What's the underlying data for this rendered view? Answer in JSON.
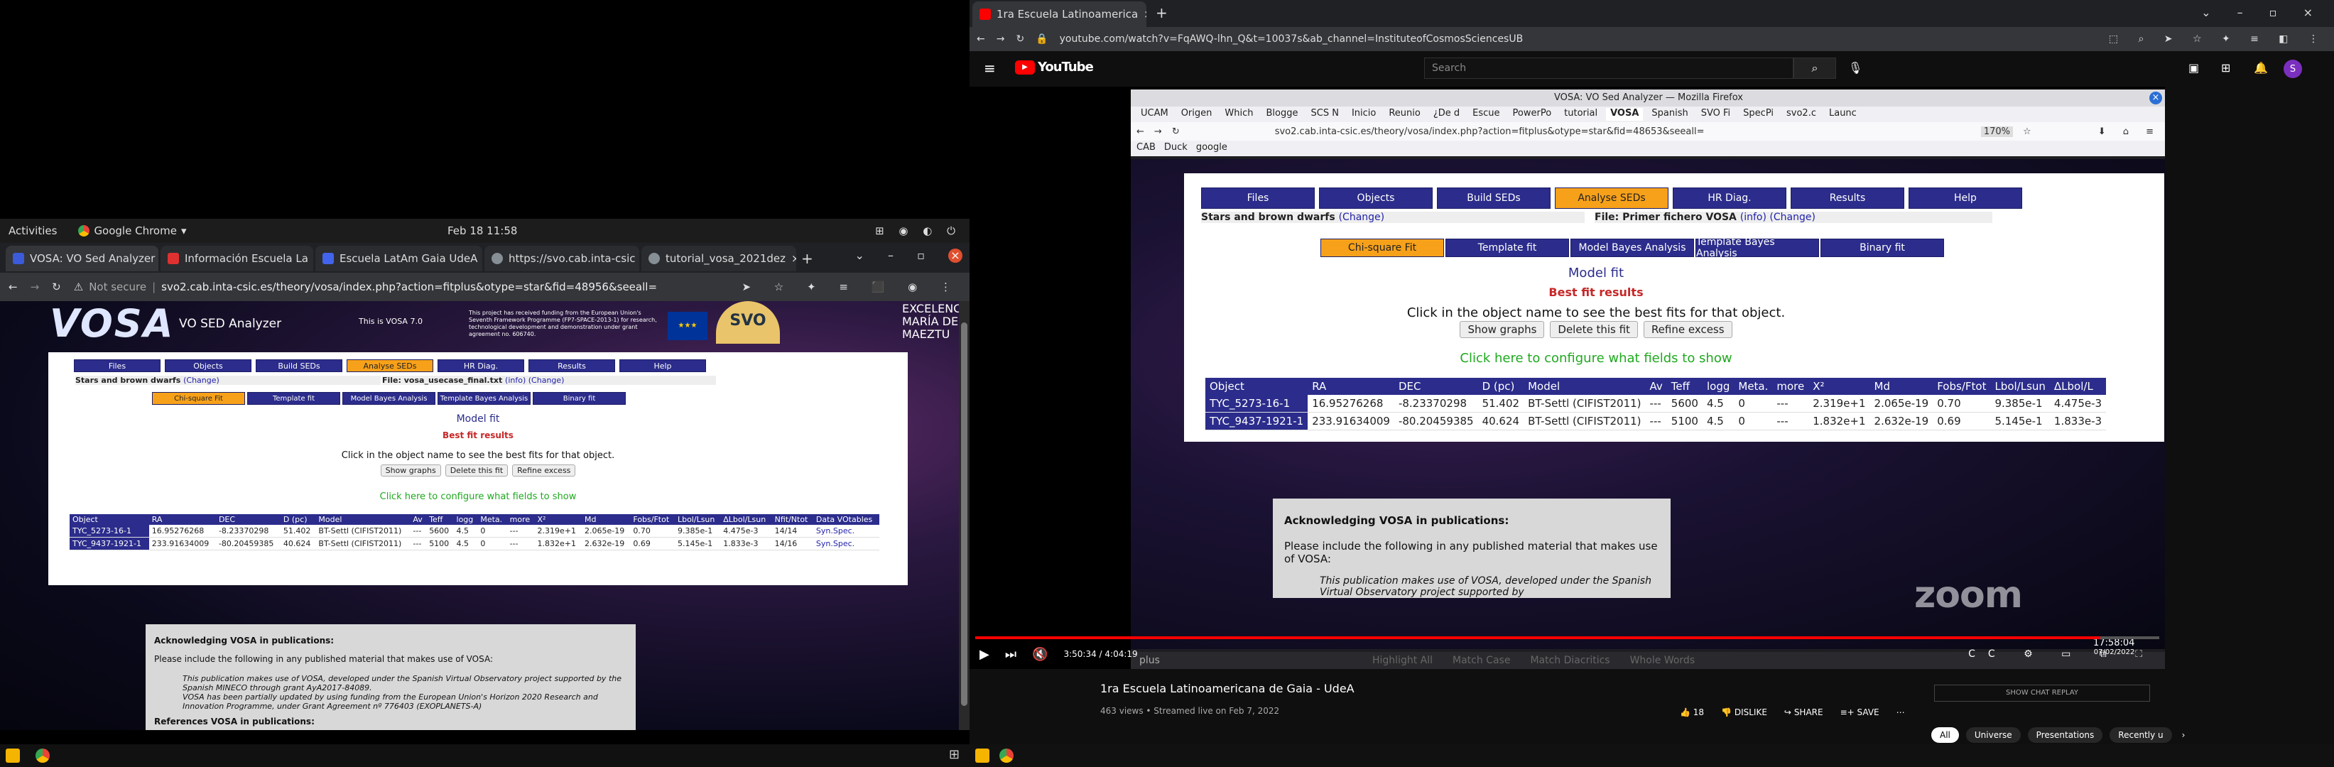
{
  "left": {
    "topbar": {
      "activities": "Activities",
      "app": "Google Chrome",
      "clock": "Feb 18  11:58"
    },
    "tabs": [
      {
        "label": "VOSA: VO Sed Analyzer",
        "color": "#3b5bdb"
      },
      {
        "label": "Información Escuela La",
        "color": "#e03131"
      },
      {
        "label": "Escuela LatAm Gaia UdeA",
        "color": "#4263eb"
      },
      {
        "label": "https://svo.cab.inta-csic",
        "color": "#868e96"
      },
      {
        "label": "tutorial_vosa_2021dez",
        "color": "#868e96"
      }
    ],
    "url": {
      "secure": "Not secure",
      "text": "svo2.cab.inta-csic.es/theory/vosa/index.php?action=fitplus&otype=star&fid=48956&seeall="
    },
    "header": {
      "logo": "VOSA",
      "title": "VO SED Analyzer",
      "version": "This is VOSA 7.0",
      "funding": "This project has received funding from the European Union's Seventh Framework Programme (FP7-SPACE-2013-1) for research, technological development and demonstration under grant agreement no. 606740.",
      "svo": "SVO",
      "excelencia": "EXCELENCIA MARÍA DE MAEZTU"
    },
    "nav": [
      "Files",
      "Objects",
      "Build SEDs",
      "Analyse SEDs",
      "HR Diag.",
      "Results",
      "Help"
    ],
    "info_left": "Stars and brown dwarfs",
    "info_left_link": "(Change)",
    "info_right": "File: vosa_usecase_final.txt",
    "info_right_link": "(info) (Change)",
    "subnav": [
      "Chi-square Fit",
      "Template fit",
      "Model Bayes Analysis",
      "Template Bayes Analysis",
      "Binary fit"
    ],
    "title": "Model fit",
    "subtitle": "Best fit results",
    "instr": "Click in the object name to see the best fits for that object.",
    "btns": [
      "Show graphs",
      "Delete this fit",
      "Refine excess"
    ],
    "configure": "Click here to configure what fields to show",
    "columns": [
      "Object",
      "RA",
      "DEC",
      "D (pc)",
      "Model",
      "Av",
      "Teff",
      "logg",
      "Meta.",
      "more",
      "X²",
      "Md",
      "Fobs/Ftot",
      "Lbol/Lsun",
      "ΔLbol/Lsun",
      "Nfit/Ntot",
      "Data VOtables"
    ],
    "rows": [
      [
        "TYC_5273-16-1",
        "16.95276268",
        "-8.23370298",
        "51.402",
        "BT-Settl (CIFIST2011)",
        "---",
        "5600",
        "4.5",
        "0",
        "---",
        "2.319e+1",
        "2.065e-19",
        "0.70",
        "9.385e-1",
        "4.475e-3",
        "14/14",
        "Syn.Spec."
      ],
      [
        "TYC_9437-1921-1",
        "233.91634009",
        "-80.20459385",
        "40.624",
        "BT-Settl (CIFIST2011)",
        "---",
        "5100",
        "4.5",
        "0",
        "---",
        "1.832e+1",
        "2.632e-19",
        "0.69",
        "5.145e-1",
        "1.833e-3",
        "14/16",
        "Syn.Spec."
      ]
    ],
    "ack": {
      "title": "Acknowledging VOSA in publications:",
      "intro": "Please include the following in any published material that makes use of VOSA:",
      "quote1": "This publication makes use of VOSA, developed under the Spanish Virtual Observatory project supported by the Spanish MINECO through grant AyA2017-84089.",
      "quote2": "VOSA has been partially updated by using funding from the European Union's Horizon 2020 Research and Innovation Programme, under Grant Agreement nº 776403 (EXOPLANETS-A)",
      "refs": "References VOSA in publications:"
    }
  },
  "right": {
    "tab": "1ra Escuela Latinoamerica",
    "url": "youtube.com/watch?v=FqAWQ-lhn_Q&t=10037s&ab_channel=InstituteofCosmosSciencesUB",
    "search_placeholder": "Search",
    "yt_logo": "YouTube",
    "avatar": "S",
    "ff_title": "VOSA: VO Sed Analyzer — Mozilla Firefox",
    "ff_bookmarks_top": [
      "UCAM",
      "Origen",
      "Which",
      "Blogge",
      "SCS N",
      "Inicio",
      "Reunio",
      "¿De d",
      "Escue",
      "PowerPo",
      "tutorial",
      "VOSA",
      "Spanish",
      "SVO Fi",
      "SpecPi",
      "svo2.c",
      "Launc"
    ],
    "ff_url": "svo2.cab.inta-csic.es/theory/vosa/index.php?action=fitplus&otype=star&fid=48653&seeall=",
    "ff_zoom": "170%",
    "ff_bookmarks": [
      "CAB",
      "Duck",
      "google"
    ],
    "nav": [
      "Files",
      "Objects",
      "Build SEDs",
      "Analyse SEDs",
      "HR Diag.",
      "Results",
      "Help"
    ],
    "info_left": "Stars and brown dwarfs",
    "info_left_link": "(Change)",
    "info_right": "File: Primer fichero VOSA",
    "info_right_link": "(info) (Change)",
    "subnav": [
      "Chi-square Fit",
      "Template fit",
      "Model Bayes Analysis",
      "Template Bayes Analysis",
      "Binary fit"
    ],
    "title": "Model fit",
    "subtitle": "Best fit results",
    "instr": "Click in the object name to see the best fits for that object.",
    "btns": [
      "Show graphs",
      "Delete this fit",
      "Refine excess"
    ],
    "configure": "Click here to configure what fields to show",
    "columns": [
      "Object",
      "RA",
      "DEC",
      "D (pc)",
      "Model",
      "Av",
      "Teff",
      "logg",
      "Meta.",
      "more",
      "X²",
      "Md",
      "Fobs/Ftot",
      "Lbol/Lsun",
      "ΔLbol/L"
    ],
    "rows": [
      [
        "TYC_5273-16-1",
        "16.95276268",
        "-8.23370298",
        "51.402",
        "BT-Settl (CIFIST2011)",
        "---",
        "5600",
        "4.5",
        "0",
        "---",
        "2.319e+1",
        "2.065e-19",
        "0.70",
        "9.385e-1",
        "4.475e-3"
      ],
      [
        "TYC_9437-1921-1",
        "233.91634009",
        "-80.20459385",
        "40.624",
        "BT-Settl (CIFIST2011)",
        "---",
        "5100",
        "4.5",
        "0",
        "---",
        "1.832e+1",
        "2.632e-19",
        "0.69",
        "5.145e-1",
        "1.833e-3"
      ]
    ],
    "ack": {
      "title": "Acknowledging VOSA in publications:",
      "intro": "Please include the following in any published material that makes use of VOSA:",
      "quote1": "This publication makes use of VOSA, developed under the Spanish Virtual Observatory project supported by"
    },
    "findbar": {
      "text": "plus",
      "highlight": "Highlight All",
      "match_case": "Match Case",
      "diacritics": "Match Diacritics",
      "whole": "Whole Words"
    },
    "zoom": "zoom",
    "ff_clock": "17:58:04",
    "ff_date": "07/02/2022",
    "time": "3:50:34 / 4:04:19",
    "video_title": "1ra Escuela Latinoamericana de Gaia - UdeA",
    "meta": "463 views • Streamed live on Feb 7, 2022",
    "likes": "18",
    "dislike": "DISLIKE",
    "share": "SHARE",
    "save": "SAVE",
    "chat_replay": "SHOW CHAT REPLAY",
    "chips": [
      "All",
      "Universe",
      "Presentations",
      "Recently u"
    ]
  }
}
